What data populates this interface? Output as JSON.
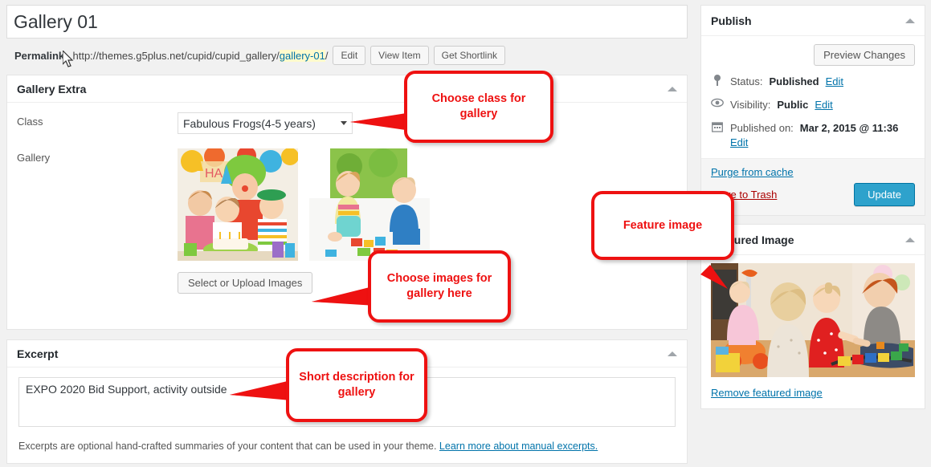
{
  "editor": {
    "title_value": "Gallery 01",
    "permalink_label": "Permalink:",
    "permalink_prefix": "http://themes.g5plus.net/cupid/cupid_gallery/",
    "permalink_slug": "gallery-01",
    "permalink_suffix": "/",
    "edit_button": "Edit",
    "view_item_button": "View Item",
    "get_shortlink_button": "Get Shortlink"
  },
  "gallery_extra": {
    "panel_title": "Gallery Extra",
    "class_label": "Class",
    "class_value": "Fabulous Frogs(4-5 years)",
    "class_options": [
      "Fabulous Frogs(4-5 years)"
    ],
    "gallery_label": "Gallery",
    "upload_button": "Select or Upload Images",
    "images": [
      {
        "alt": "Children at a birthday party with clown and cake"
      },
      {
        "alt": "Toddlers playing with colorful building blocks"
      }
    ]
  },
  "excerpt": {
    "panel_title": "Excerpt",
    "value": "EXPO 2020 Bid Support, activity outside",
    "placeholder": "",
    "help_text": "Excerpts are optional hand-crafted summaries of your content that can be used in your theme.",
    "help_link": "Learn more about manual excerpts."
  },
  "publish": {
    "panel_title": "Publish",
    "preview_button": "Preview Changes",
    "status_label": "Status:",
    "status_value": "Published",
    "status_edit": "Edit",
    "visibility_label": "Visibility:",
    "visibility_value": "Public",
    "visibility_edit": "Edit",
    "published_label": "Published on:",
    "published_value": "Mar 2, 2015 @ 11:36",
    "published_edit": "Edit",
    "purge_link": "Purge from cache",
    "trash_link": "Move to Trash",
    "update_button": "Update"
  },
  "featured": {
    "panel_title": "Featured Image",
    "remove_link": "Remove featured image",
    "image_alt": "Adult and three young children playing with toys on the floor"
  },
  "annotations": [
    {
      "id": "class-callout",
      "text": "Choose class for gallery"
    },
    {
      "id": "images-callout",
      "text": "Choose images for gallery here"
    },
    {
      "id": "feature-callout",
      "text": "Feature image"
    },
    {
      "id": "excerpt-callout",
      "text": "Short description for gallery"
    }
  ],
  "colors": {
    "annotation": "#ee1111",
    "primary_button": "#2ea2cc",
    "link": "#0073aa",
    "trash": "#aa0000",
    "highlight": "#fffbcc"
  }
}
